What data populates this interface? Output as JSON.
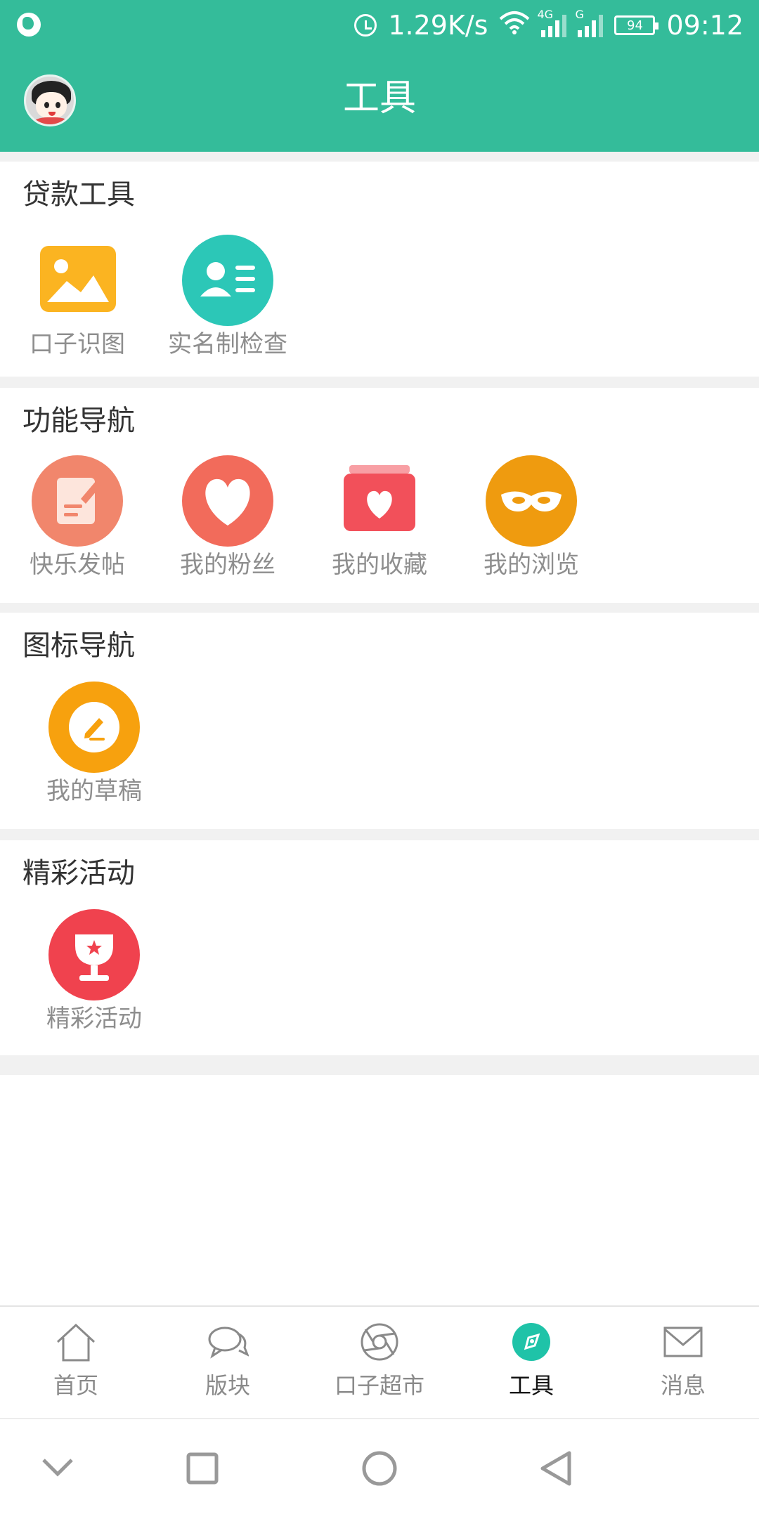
{
  "status_bar": {
    "speed": "1.29K/s",
    "net1": "4G",
    "net2": "G",
    "battery": "94",
    "time": "09:12"
  },
  "header": {
    "title": "工具"
  },
  "sections": [
    {
      "title": "贷款工具",
      "items": [
        {
          "label": "口子识图"
        },
        {
          "label": "实名制检查"
        }
      ]
    },
    {
      "title": "功能导航",
      "items": [
        {
          "label": "快乐发帖"
        },
        {
          "label": "我的粉丝"
        },
        {
          "label": "我的收藏"
        },
        {
          "label": "我的浏览"
        }
      ]
    },
    {
      "title": "图标导航",
      "items": [
        {
          "label": "我的草稿"
        }
      ]
    },
    {
      "title": "精彩活动",
      "items": [
        {
          "label": "精彩活动"
        }
      ]
    }
  ],
  "tabs": [
    {
      "label": "首页",
      "icon": "home-icon"
    },
    {
      "label": "版块",
      "icon": "chat-bubbles-icon"
    },
    {
      "label": "口子超市",
      "icon": "aperture-icon"
    },
    {
      "label": "工具",
      "icon": "compass-icon",
      "active": true
    },
    {
      "label": "消息",
      "icon": "mail-icon"
    }
  ],
  "colors": {
    "brand": "#34bc9a",
    "image_orange": "#fbb421",
    "id_teal": "#2cc7b7",
    "post_salmon": "#f1866c",
    "fans_red": "#f26b5b",
    "fav_red": "#f2505a",
    "browse_orange": "#ef9b0f",
    "draft_orange": "#f7a10e",
    "activity_red": "#f0424e"
  }
}
